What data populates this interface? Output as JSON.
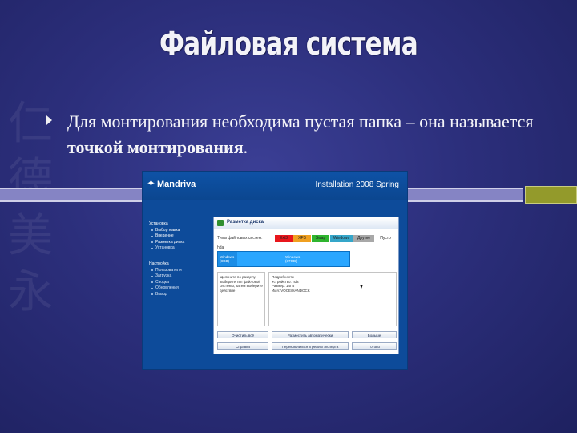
{
  "slide": {
    "title": "Файловая система",
    "bullet": {
      "text_before": "Для монтирования необходима пустая папка – она называется ",
      "text_bold": "точкой монтирования",
      "text_after": "."
    }
  },
  "screenshot": {
    "logo": "Mandriva",
    "header_title": "Installation 2008 Spring",
    "sidebar": {
      "install_group": "Установка",
      "install_items": [
        "Выбор языка",
        "Введение",
        "Разметка диска",
        "Установка"
      ],
      "config_group": "Настройка",
      "config_items": [
        "Пользователи",
        "Загрузка",
        "Сводка",
        "Обновления",
        "Выход"
      ]
    },
    "window": {
      "title": "Разметка диска",
      "fs_label": "Типы файловых систем:",
      "fs_chips": [
        "Ext3",
        "XFS",
        "Swap",
        "Windows",
        "Другие",
        "Пусто"
      ],
      "fs_colors": [
        "#e8161c",
        "#f0a020",
        "#2fb52f",
        "#35a6c9",
        "#a8a8a8",
        "#ffffff"
      ],
      "disk_label": "hda",
      "disk_part1": [
        "Windows",
        "(8GB)"
      ],
      "disk_part2": [
        "Windows",
        "(37GB)"
      ],
      "left_panel_text": "Щелкните по разделу, выберите тип файловой системы, затем выберите действие",
      "details": [
        "Подробности",
        "Устройство: hda",
        "Размер: 14ГБ",
        "Имя: VOCE/HANDOCK"
      ],
      "buttons_row1": [
        "Очистить всё",
        "Разместить автоматически",
        "Больше"
      ],
      "buttons_row2": [
        "Справка",
        "Переключиться в режим эксперта",
        "Готово"
      ]
    }
  }
}
